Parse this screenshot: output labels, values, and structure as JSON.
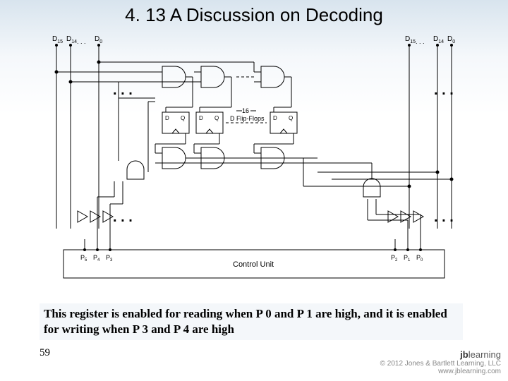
{
  "slide": {
    "title": "4. 13 A Discussion on Decoding",
    "caption": "This register is enabled for reading when P 0 and P 1 are high, and it is enabled for writing when P 3 and P 4 are high",
    "page_number": "59",
    "copyright_line": "© 2012 Jones & Bartlett Learning, LLC",
    "site": "www.jblearning.com",
    "brand_prefix": "jb",
    "brand_suffix": "learning"
  },
  "diagram": {
    "bus_labels_left": [
      "D",
      "D",
      "D"
    ],
    "bus_subs_left": [
      "15",
      "14",
      "0"
    ],
    "bus_labels_right": [
      "D",
      "D",
      "D"
    ],
    "bus_subs_right": [
      "15",
      "14",
      "0"
    ],
    "ellipsis": ". . .",
    "ellipsis_small": ". . .",
    "ff_block_top": "16",
    "ff_block_label": "D Flip-Flops",
    "ff_pin_d": "D",
    "ff_pin_q": "Q",
    "cu_label": "Control Unit",
    "cu_pins_left": [
      "P",
      "P",
      "P"
    ],
    "cu_pins_left_sub": [
      "5",
      "4",
      "3"
    ],
    "cu_pins_right": [
      "P",
      "P",
      "P"
    ],
    "cu_pins_right_sub": [
      "2",
      "1",
      "0"
    ]
  }
}
